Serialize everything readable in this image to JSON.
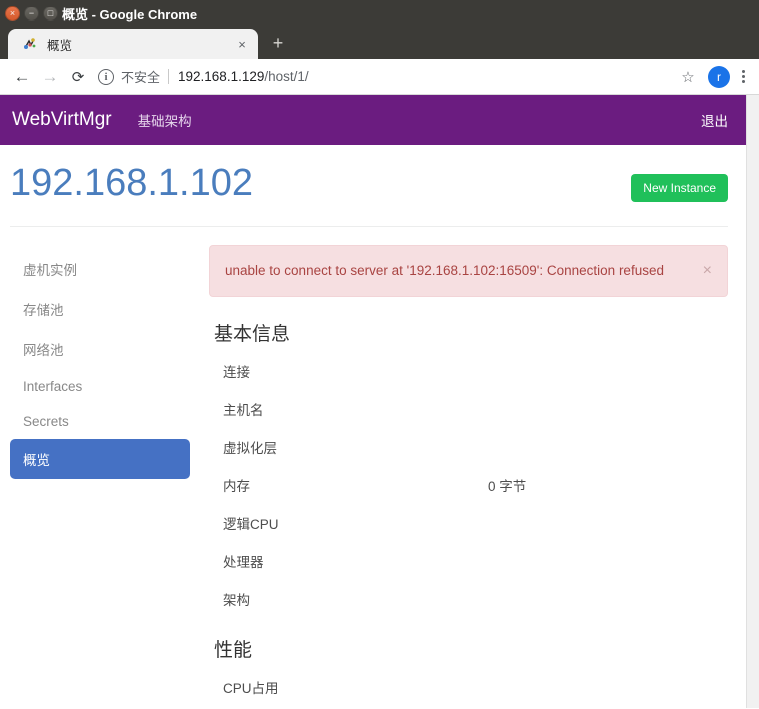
{
  "window": {
    "title": "概览 - Google Chrome",
    "controls": {
      "close": "×",
      "minimize": "−",
      "maximize": "□"
    }
  },
  "browser": {
    "tab": {
      "title": "概览",
      "close_label": "×"
    },
    "new_tab_label": "+",
    "nav": {
      "back": "←",
      "forward": "→",
      "reload": "⟳"
    },
    "omnibox": {
      "info_glyph": "i",
      "security_label": "不安全",
      "url_host": "192.168.1.129",
      "url_path": "/host/1/"
    },
    "bookmark_star": "☆",
    "avatar_letter": "r",
    "menu_label": "⋮"
  },
  "navbar": {
    "brand": "WebVirtMgr",
    "link": "基础架构",
    "logout": "退出"
  },
  "header": {
    "title": "192.168.1.102",
    "new_instance_label": "New Instance"
  },
  "sidebar": {
    "items": [
      {
        "label": "虚机实例",
        "active": false
      },
      {
        "label": "存储池",
        "active": false
      },
      {
        "label": "网络池",
        "active": false
      },
      {
        "label": "Interfaces",
        "active": false
      },
      {
        "label": "Secrets",
        "active": false
      },
      {
        "label": "概览",
        "active": true
      }
    ]
  },
  "alert": {
    "message": "unable to connect to server at '192.168.1.102:16509': Connection refused",
    "close_label": "×"
  },
  "basic_info": {
    "title": "基本信息",
    "rows": [
      {
        "label": "连接",
        "value": ""
      },
      {
        "label": "主机名",
        "value": ""
      },
      {
        "label": "虚拟化层",
        "value": ""
      },
      {
        "label": "内存",
        "value": "0 字节"
      },
      {
        "label": "逻辑CPU",
        "value": ""
      },
      {
        "label": "处理器",
        "value": ""
      },
      {
        "label": "架构",
        "value": ""
      }
    ]
  },
  "performance": {
    "title": "性能",
    "rows": [
      {
        "label": "CPU占用",
        "value": ""
      }
    ]
  },
  "colors": {
    "navbar_purple": "#6b1c80",
    "accent_blue": "#4571c4",
    "title_blue": "#4a7dbd",
    "button_green": "#20c05a",
    "alert_bg": "#f6dfe1",
    "alert_text": "#a94442"
  }
}
